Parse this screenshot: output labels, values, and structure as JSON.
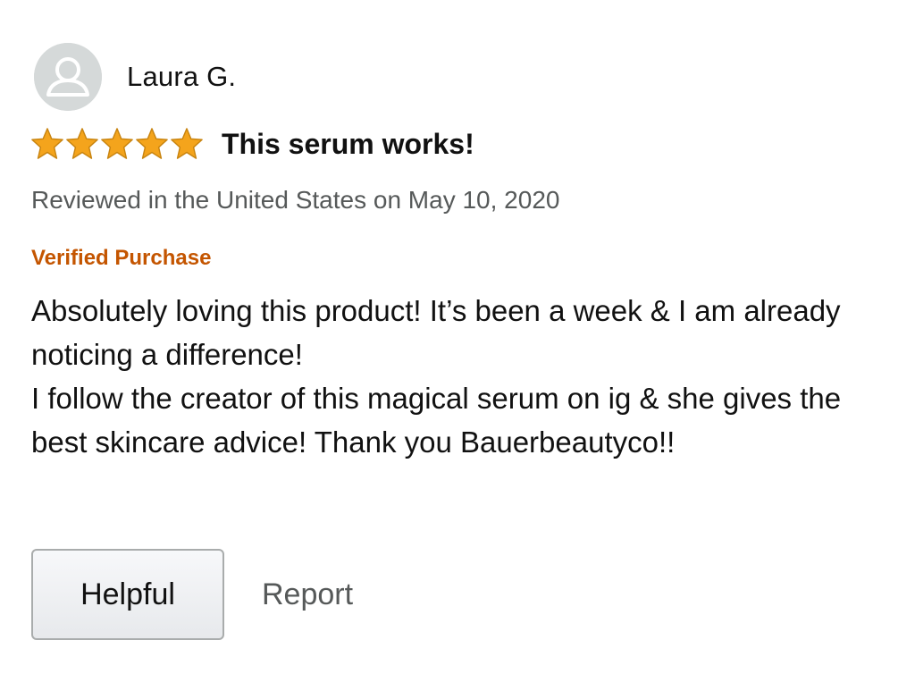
{
  "reviewer": {
    "name": "Laura G.",
    "avatar_icon": "user-avatar-icon"
  },
  "rating": {
    "stars": 5,
    "max": 5,
    "star_color": "#f4a41c"
  },
  "review": {
    "title": "This serum works!",
    "meta": "Reviewed in the United States on May 10, 2020",
    "verified_label": "Verified Purchase",
    "body_lines": [
      "Absolutely loving this product! It’s been a week & I am already noticing a difference!",
      "I follow the creator of this magical serum on ig & she gives the best skincare advice! Thank you Bauerbeautyco!!"
    ]
  },
  "actions": {
    "helpful_label": "Helpful",
    "report_label": "Report"
  },
  "colors": {
    "verified": "#c45500",
    "meta_text": "#565959"
  }
}
